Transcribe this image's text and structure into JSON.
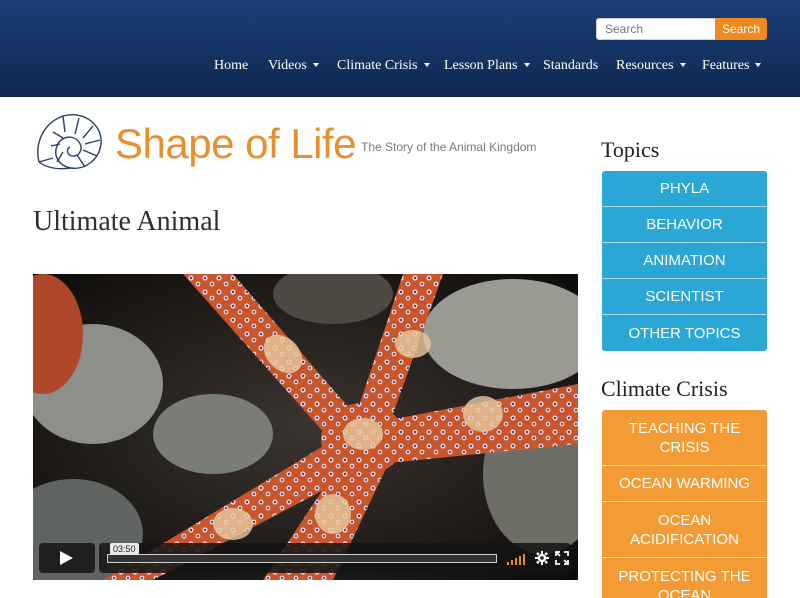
{
  "search": {
    "placeholder": "Search",
    "button_label": "Search"
  },
  "nav": {
    "items": [
      {
        "label": "Home",
        "dropdown": false
      },
      {
        "label": "Videos",
        "dropdown": true
      },
      {
        "label": "Climate Crisis",
        "dropdown": true
      },
      {
        "label": "Lesson Plans",
        "dropdown": true
      },
      {
        "label": "Standards",
        "dropdown": false
      },
      {
        "label": "Resources",
        "dropdown": true
      },
      {
        "label": "Features",
        "dropdown": true
      }
    ]
  },
  "logo": {
    "name": "Shape of Life",
    "tagline": "The Story of the Animal Kingdom"
  },
  "page": {
    "title": "Ultimate Animal"
  },
  "video": {
    "time": "03:50",
    "icons": [
      "play-icon",
      "volume-icon",
      "gear-icon",
      "fullscreen-icon"
    ]
  },
  "sidebar": {
    "topics": {
      "heading": "Topics",
      "items": [
        "PHYLA",
        "BEHAVIOR",
        "ANIMATION",
        "SCIENTIST",
        "OTHER TOPICS"
      ]
    },
    "climate": {
      "heading": "Climate Crisis",
      "items": [
        "TEACHING THE CRISIS",
        "OCEAN WARMING",
        "OCEAN ACIDIFICATION",
        "PROTECTING THE OCEAN"
      ]
    }
  },
  "colors": {
    "header": "#163566",
    "accent_orange": "#f0891f",
    "topic_blue": "#2aa7d4",
    "climate_orange": "#f39b35",
    "logo_orange": "#e8902f"
  }
}
